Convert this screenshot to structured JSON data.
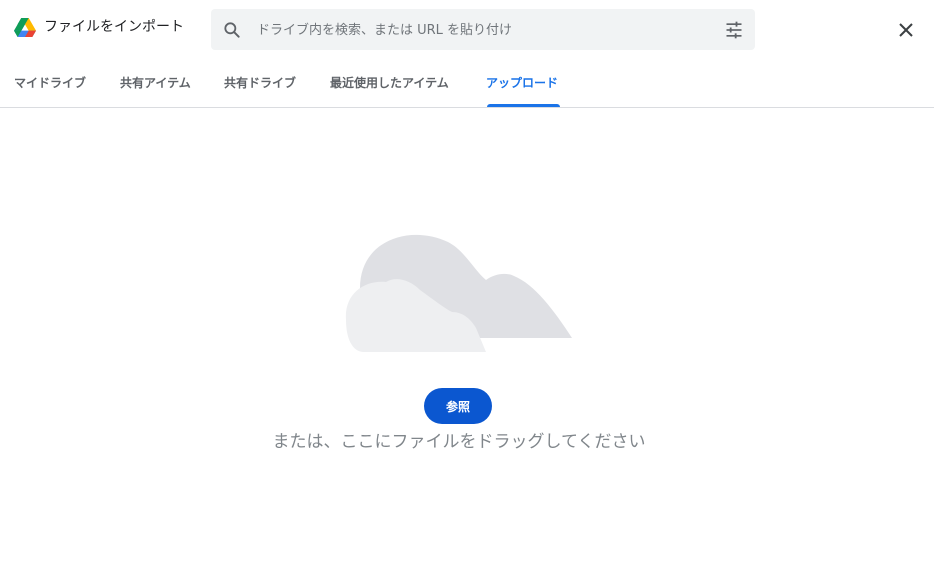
{
  "header": {
    "title": "ファイルをインポート",
    "logo_icon": "google-drive-logo",
    "close_icon": "close-icon"
  },
  "search": {
    "placeholder": "ドライブ内を検索、または URL を貼り付け",
    "value": "",
    "search_icon": "search-icon",
    "filter_icon": "tune-icon"
  },
  "tabs": [
    {
      "label": "マイドライブ",
      "active": false
    },
    {
      "label": "共有アイテム",
      "active": false
    },
    {
      "label": "共有ドライブ",
      "active": false
    },
    {
      "label": "最近使用したアイテム",
      "active": false
    },
    {
      "label": "アップロード",
      "active": true
    }
  ],
  "upload": {
    "illustration_icon": "cloud-illustration",
    "browse_label": "参照",
    "drag_text": "または、ここにファイルをドラッグしてください"
  },
  "colors": {
    "accent": "#1a73e8",
    "button": "#0b57d0",
    "tab_inactive": "#5f6368",
    "secondary_text": "#80868b",
    "search_bg": "#f1f3f4",
    "cloud_back": "#dfe0e4",
    "cloud_front": "#eeeff1"
  }
}
